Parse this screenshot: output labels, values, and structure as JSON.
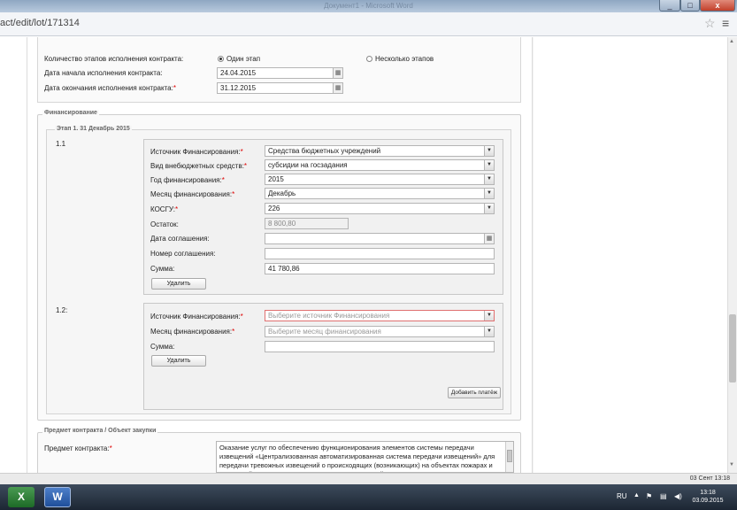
{
  "window": {
    "title": "Документ1 - Microsoft Word",
    "min_label": "_",
    "max_label": "□",
    "close_label": "x"
  },
  "browser": {
    "url": "act/edit/lot/171314",
    "star_icon": "☆",
    "menu_icon": "≡"
  },
  "contract": {
    "stages_label": "Количество этапов исполнения контракта:",
    "option_one": "Один этап",
    "option_multi": "Несколько этапов",
    "start_label": "Дата начала исполнения контракта:",
    "start_value": "24.04.2015",
    "end_label": "Дата окончания исполнения контракта:",
    "end_value": "31.12.2015"
  },
  "financing": {
    "legend": "Финансирование",
    "stage_legend": "Этап 1. 31 Декабрь 2015",
    "item1": {
      "number": "1.1",
      "source_label": "Источник Финансирования:",
      "source_value": "Средства бюджетных учреждений",
      "extra_label": "Вид внебюджетных средств:",
      "extra_value": "субсидии на госзадания",
      "year_label": "Год финансирования:",
      "year_value": "2015",
      "month_label": "Месяц финансирования:",
      "month_value": "Декабрь",
      "kosgu_label": "КОСГУ:",
      "kosgu_value": "226",
      "rest_label": "Остаток:",
      "rest_value": "8 800,80",
      "agreement_date_label": "Дата соглашения:",
      "agreement_num_label": "Номер соглашения:",
      "sum_label": "Сумма:",
      "sum_value": "41 780,86",
      "delete_label": "Удалить"
    },
    "item2": {
      "number": "1.2:",
      "source_label": "Источник Финансирования:",
      "source_placeholder": "Выберите источник Финансирования",
      "month_label": "Месяц финансирования:",
      "month_placeholder": "Выберите месяц финансирования",
      "sum_label": "Сумма:",
      "delete_label": "Удалить"
    },
    "add_payment_label": "Добавить платёж"
  },
  "subject": {
    "legend": "Предмет контракта / Объект закупки",
    "label": "Предмет контракта:",
    "text": "Оказание услуг по обеспечению функционирования элементов системы передачи извещений «Централизованная автоматизированная система передачи извещений» для передачи тревожных извещений о происходящих (возникающих) на объектах пожарах и чрезвычайных ситуациях в подразделения пожарной охраны от систем"
  },
  "status": {
    "text": "03 Сент 13:18"
  },
  "taskbar": {
    "excel_label": "X",
    "word_label": "W",
    "lang": "RU",
    "time": "13:18",
    "date": "03.09.2015"
  }
}
